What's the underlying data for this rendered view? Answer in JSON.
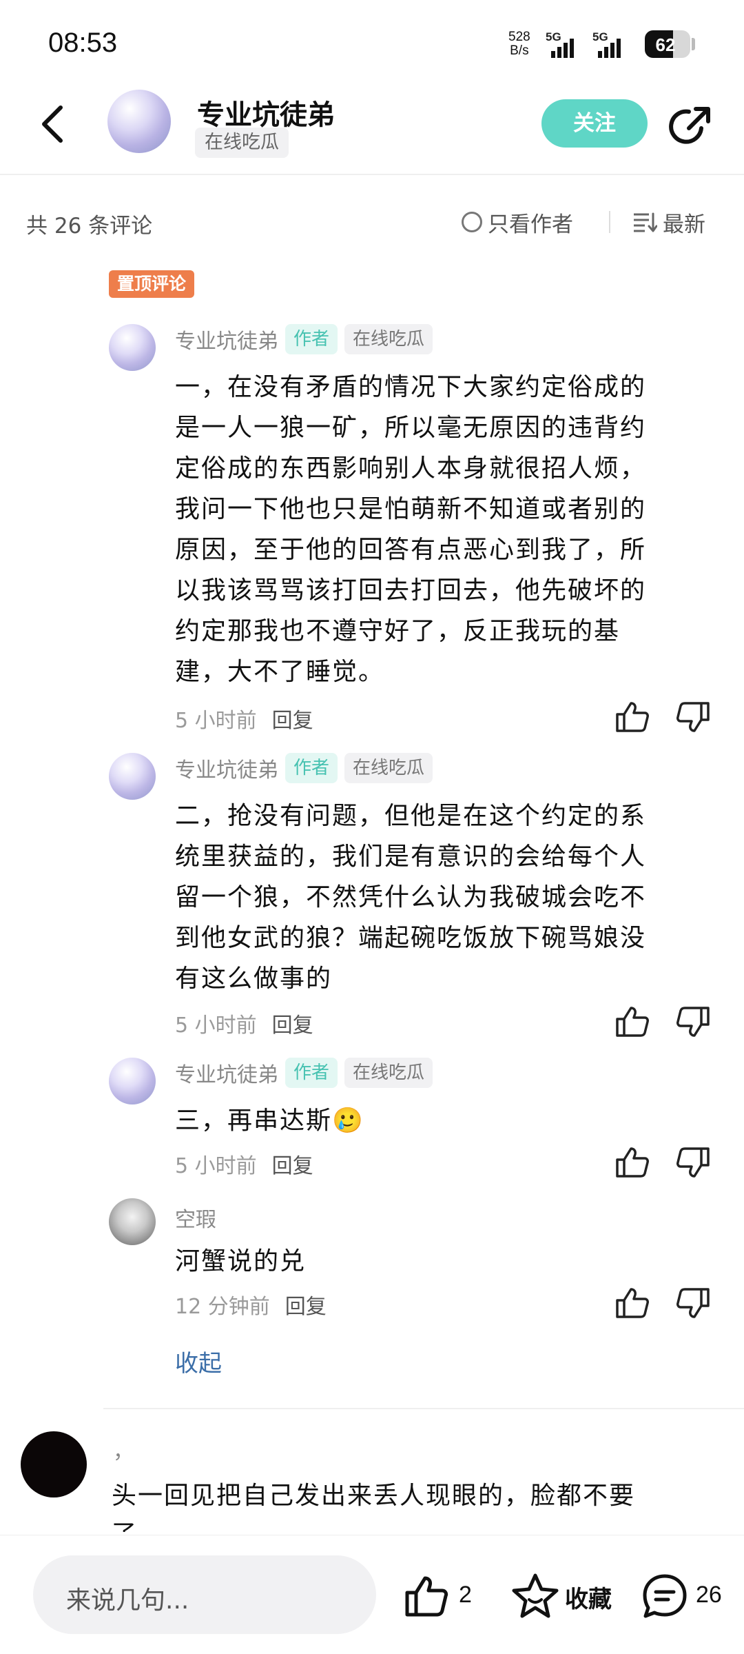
{
  "status_bar": {
    "time": "08:53",
    "net_speed_value": "528",
    "net_speed_unit": "B/s",
    "signal1_label": "5G",
    "signal2_label": "5G",
    "battery": "62"
  },
  "header": {
    "author_name": "专业坑徒弟",
    "author_tag": "在线吃瓜",
    "follow_label": "关注"
  },
  "toolbar": {
    "comment_count_text": "共 26 条评论",
    "author_only_label": "只看作者",
    "sort_label": "最新"
  },
  "pinned_label": "置顶评论",
  "comments": [
    {
      "name": "专业坑徒弟",
      "author_badge": "作者",
      "tag": "在线吃瓜",
      "lines": [
        "一，在没有矛盾的情况下大家约定俗成的",
        "是一人一狼一矿，所以毫无原因的违背约",
        "定俗成的东西影响别人本身就很招人烦，",
        "我问一下他也只是怕萌新不知道或者别的",
        "原因，至于他的回答有点恶心到我了，所",
        "以我该骂骂该打回去打回去，他先破坏的",
        "约定那我也不遵守好了，反正我玩的基",
        "建，大不了睡觉。"
      ],
      "time": "5 小时前",
      "reply_label": "回复"
    },
    {
      "name": "专业坑徒弟",
      "author_badge": "作者",
      "tag": "在线吃瓜",
      "lines": [
        "二，抢没有问题，但他是在这个约定的系",
        "统里获益的，我们是有意识的会给每个人",
        "留一个狼，不然凭什么认为我破城会吃不",
        "到他女武的狼？端起碗吃饭放下碗骂娘没",
        "有这么做事的"
      ],
      "time": "5 小时前",
      "reply_label": "回复"
    },
    {
      "name": "专业坑徒弟",
      "author_badge": "作者",
      "tag": "在线吃瓜",
      "lines": [
        "三，再串达斯"
      ],
      "emoji": "🥲",
      "time": "5 小时前",
      "reply_label": "回复"
    },
    {
      "name": "空瑕",
      "lines": [
        "河蟹说的兑"
      ],
      "time": "12 分钟前",
      "reply_label": "回复"
    }
  ],
  "collapse_label": "收起",
  "next_comment": {
    "name": "，",
    "text": "头一回见把自己发出来丢人现眼的，脸都不要",
    "text_continued": "了"
  },
  "bottom_bar": {
    "input_placeholder": "来说几句...",
    "like_count": "2",
    "favorite_label": "收藏",
    "comment_count": "26"
  },
  "colors": {
    "accent": "#5fd6c6",
    "pinned": "#ee7e4b",
    "link": "#3b6ea8"
  }
}
